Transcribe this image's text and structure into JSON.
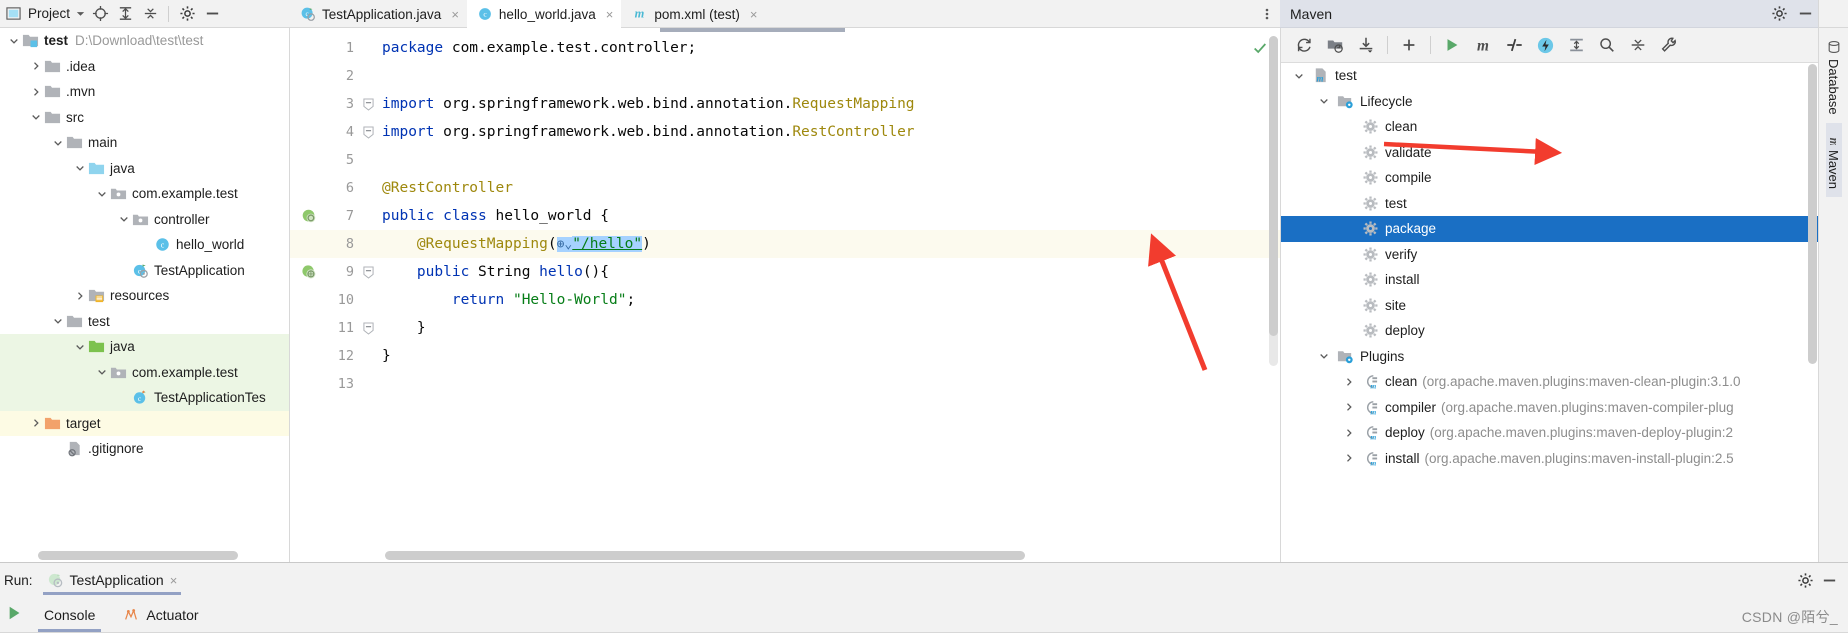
{
  "project_panel": {
    "title": "Project",
    "toolbar_icons": [
      "locate-icon",
      "expand-all-icon",
      "collapse-all-icon",
      "settings-gear-icon",
      "hide-icon"
    ],
    "tree": [
      {
        "label": "test",
        "sub": "D:\\Download\\test\\test",
        "indent": 0,
        "arrow": "down",
        "icon": "module-folder-icon",
        "bold": true,
        "bg": "none"
      },
      {
        "label": ".idea",
        "sub": "",
        "indent": 1,
        "arrow": "right",
        "icon": "folder-icon",
        "bold": false,
        "bg": "none"
      },
      {
        "label": ".mvn",
        "sub": "",
        "indent": 1,
        "arrow": "right",
        "icon": "folder-icon",
        "bold": false,
        "bg": "none"
      },
      {
        "label": "src",
        "sub": "",
        "indent": 1,
        "arrow": "down",
        "icon": "folder-icon",
        "bold": false,
        "bg": "none"
      },
      {
        "label": "main",
        "sub": "",
        "indent": 2,
        "arrow": "down",
        "icon": "folder-icon",
        "bold": false,
        "bg": "none"
      },
      {
        "label": "java",
        "sub": "",
        "indent": 3,
        "arrow": "down",
        "icon": "source-folder-icon",
        "bold": false,
        "bg": "none"
      },
      {
        "label": "com.example.test",
        "sub": "",
        "indent": 4,
        "arrow": "down",
        "icon": "package-icon",
        "bold": false,
        "bg": "none"
      },
      {
        "label": "controller",
        "sub": "",
        "indent": 5,
        "arrow": "down",
        "icon": "package-icon",
        "bold": false,
        "bg": "none"
      },
      {
        "label": "hello_world",
        "sub": "",
        "indent": 6,
        "arrow": "none",
        "icon": "java-class-icon",
        "bold": false,
        "bg": "none"
      },
      {
        "label": "TestApplication",
        "sub": "",
        "indent": 5,
        "arrow": "none",
        "icon": "spring-class-icon",
        "bold": false,
        "bg": "none"
      },
      {
        "label": "resources",
        "sub": "",
        "indent": 3,
        "arrow": "right",
        "icon": "resources-folder-icon",
        "bold": false,
        "bg": "none"
      },
      {
        "label": "test",
        "sub": "",
        "indent": 2,
        "arrow": "down",
        "icon": "folder-icon",
        "bold": false,
        "bg": "none"
      },
      {
        "label": "java",
        "sub": "",
        "indent": 3,
        "arrow": "down",
        "icon": "test-source-folder-icon",
        "bold": false,
        "bg": "green"
      },
      {
        "label": "com.example.test",
        "sub": "",
        "indent": 4,
        "arrow": "down",
        "icon": "package-icon",
        "bold": false,
        "bg": "green"
      },
      {
        "label": "TestApplicationTes",
        "sub": "",
        "indent": 5,
        "arrow": "none",
        "icon": "test-class-icon",
        "bold": false,
        "bg": "green"
      },
      {
        "label": "target",
        "sub": "",
        "indent": 1,
        "arrow": "right",
        "icon": "excluded-folder-icon",
        "bold": false,
        "bg": "yellow"
      },
      {
        "label": ".gitignore",
        "sub": "",
        "indent": 2,
        "arrow": "none",
        "icon": "gitignore-file-icon",
        "bold": false,
        "bg": "none"
      }
    ]
  },
  "editor": {
    "tabs": [
      {
        "label": "TestApplication.java",
        "icon": "spring-class-icon",
        "active": false,
        "close": "×"
      },
      {
        "label": "hello_world.java",
        "icon": "java-class-icon",
        "active": true,
        "close": "×"
      },
      {
        "label": "pom.xml (test)",
        "icon": "maven-m-icon",
        "active": false,
        "close": "×"
      }
    ],
    "more_icon": "more-vertical-icon",
    "inspection_status": "check-ok-icon",
    "lines": [
      {
        "num": "1",
        "gutter": "",
        "fold": "",
        "segments": [
          {
            "t": "package",
            "c": "kw"
          },
          {
            "t": " com.example.test.controller;",
            "c": "plain"
          }
        ]
      },
      {
        "num": "2",
        "gutter": "",
        "fold": "",
        "segments": []
      },
      {
        "num": "3",
        "gutter": "",
        "fold": "minus",
        "segments": [
          {
            "t": "import",
            "c": "kw"
          },
          {
            "t": " org.springframework.web.bind.annotation.",
            "c": "plain"
          },
          {
            "t": "RequestMapping",
            "c": "ann"
          }
        ]
      },
      {
        "num": "4",
        "gutter": "",
        "fold": "minus",
        "segments": [
          {
            "t": "import",
            "c": "kw"
          },
          {
            "t": " org.springframework.web.bind.annotation.",
            "c": "plain"
          },
          {
            "t": "RestController",
            "c": "ann"
          }
        ]
      },
      {
        "num": "5",
        "gutter": "",
        "fold": "",
        "segments": []
      },
      {
        "num": "6",
        "gutter": "",
        "fold": "",
        "segments": [
          {
            "t": "@RestController",
            "c": "ann"
          }
        ]
      },
      {
        "num": "7",
        "gutter": "spring-bean-icon",
        "fold": "",
        "segments": [
          {
            "t": "public",
            "c": "kw"
          },
          {
            "t": " ",
            "c": "plain"
          },
          {
            "t": "class",
            "c": "kw"
          },
          {
            "t": " hello_world {",
            "c": "plain"
          }
        ]
      },
      {
        "num": "8",
        "gutter": "",
        "fold": "",
        "highlight": true,
        "segments": [
          {
            "t": "    @RequestMapping",
            "c": "ann"
          },
          {
            "t": "(",
            "c": "plain"
          },
          {
            "t": "⊕⌄",
            "c": "gutter-inline"
          },
          {
            "t": "\"/hello\"",
            "c": "str-sel"
          },
          {
            "t": ")",
            "c": "plain"
          }
        ]
      },
      {
        "num": "9",
        "gutter": "spring-url-icon",
        "fold": "minus",
        "segments": [
          {
            "t": "    ",
            "c": "plain"
          },
          {
            "t": "public",
            "c": "kw"
          },
          {
            "t": " String ",
            "c": "plain"
          },
          {
            "t": "hello",
            "c": "kw-method"
          },
          {
            "t": "(){",
            "c": "plain"
          }
        ]
      },
      {
        "num": "10",
        "gutter": "",
        "fold": "",
        "segments": [
          {
            "t": "        ",
            "c": "plain"
          },
          {
            "t": "return",
            "c": "kw"
          },
          {
            "t": " ",
            "c": "plain"
          },
          {
            "t": "\"Hello-World\"",
            "c": "str"
          },
          {
            "t": ";",
            "c": "plain"
          }
        ]
      },
      {
        "num": "11",
        "gutter": "",
        "fold": "minus",
        "segments": [
          {
            "t": "    }",
            "c": "plain"
          }
        ]
      },
      {
        "num": "12",
        "gutter": "",
        "fold": "",
        "segments": [
          {
            "t": "}",
            "c": "plain"
          }
        ]
      },
      {
        "num": "13",
        "gutter": "",
        "fold": "",
        "segments": []
      }
    ]
  },
  "maven_panel": {
    "title": "Maven",
    "header_icons": [
      "settings-gear-icon",
      "minimize-icon"
    ],
    "toolbar_icons": [
      "reload-all-projects-icon",
      "add-maven-project-icon",
      "download-sources-icon",
      "add-icon",
      "run-icon",
      "maven-m-icon",
      "toggle-skip-tests-icon",
      "execute-goal-icon",
      "expand-collapse-icon",
      "search-icon",
      "collapse-all-icon",
      "settings-wrench-icon"
    ],
    "tree": [
      {
        "label": "test",
        "sub": "",
        "indent": 0,
        "arrow": "down",
        "icon": "maven-project-icon",
        "selected": false
      },
      {
        "label": "Lifecycle",
        "sub": "",
        "indent": 1,
        "arrow": "down",
        "icon": "lifecycle-folder-icon",
        "selected": false
      },
      {
        "label": "clean",
        "sub": "",
        "indent": 2,
        "arrow": "none",
        "icon": "goal-gear-icon",
        "selected": false
      },
      {
        "label": "validate",
        "sub": "",
        "indent": 2,
        "arrow": "none",
        "icon": "goal-gear-icon",
        "selected": false
      },
      {
        "label": "compile",
        "sub": "",
        "indent": 2,
        "arrow": "none",
        "icon": "goal-gear-icon",
        "selected": false
      },
      {
        "label": "test",
        "sub": "",
        "indent": 2,
        "arrow": "none",
        "icon": "goal-gear-icon",
        "selected": false
      },
      {
        "label": "package",
        "sub": "",
        "indent": 2,
        "arrow": "none",
        "icon": "goal-gear-icon",
        "selected": true
      },
      {
        "label": "verify",
        "sub": "",
        "indent": 2,
        "arrow": "none",
        "icon": "goal-gear-icon",
        "selected": false
      },
      {
        "label": "install",
        "sub": "",
        "indent": 2,
        "arrow": "none",
        "icon": "goal-gear-icon",
        "selected": false
      },
      {
        "label": "site",
        "sub": "",
        "indent": 2,
        "arrow": "none",
        "icon": "goal-gear-icon",
        "selected": false
      },
      {
        "label": "deploy",
        "sub": "",
        "indent": 2,
        "arrow": "none",
        "icon": "goal-gear-icon",
        "selected": false
      },
      {
        "label": "Plugins",
        "sub": "",
        "indent": 1,
        "arrow": "down",
        "icon": "plugins-folder-icon",
        "selected": false
      },
      {
        "label": "clean",
        "sub": "(org.apache.maven.plugins:maven-clean-plugin:3.1.0",
        "indent": 2,
        "arrow": "right",
        "icon": "plugin-icon",
        "selected": false
      },
      {
        "label": "compiler",
        "sub": "(org.apache.maven.plugins:maven-compiler-plug",
        "indent": 2,
        "arrow": "right",
        "icon": "plugin-icon",
        "selected": false
      },
      {
        "label": "deploy",
        "sub": "(org.apache.maven.plugins:maven-deploy-plugin:2",
        "indent": 2,
        "arrow": "right",
        "icon": "plugin-icon",
        "selected": false
      },
      {
        "label": "install",
        "sub": "(org.apache.maven.plugins:maven-install-plugin:2.5",
        "indent": 2,
        "arrow": "right",
        "icon": "plugin-icon",
        "selected": false
      }
    ]
  },
  "right_rail": [
    {
      "label": "Database",
      "icon": "database-icon",
      "active": false
    },
    {
      "label": "Maven",
      "icon": "maven-m-icon",
      "active": true
    }
  ],
  "run_panel": {
    "run_label": "Run:",
    "config_tab": {
      "label": "TestApplication",
      "icon": "spring-run-icon",
      "close": "×"
    },
    "right_icons": [
      "settings-gear-icon",
      "minimize-icon"
    ],
    "subtabs": [
      {
        "label": "Console",
        "icon": "",
        "active": true
      },
      {
        "label": "Actuator",
        "icon": "actuator-icon",
        "active": false
      }
    ],
    "side_icon": "rerun-icon"
  },
  "watermark": "CSDN @陌兮_",
  "colors": {
    "selection_blue": "#1a6fc4",
    "annotation_gold": "#9e880d",
    "keyword_blue": "#0033b3",
    "string_green": "#067d17",
    "arrow_red": "#f23c2e",
    "maven_header_bg": "#dfe2ea",
    "test_source_green": "#ecf6e4",
    "excluded_yellow": "#fdfbe4"
  }
}
